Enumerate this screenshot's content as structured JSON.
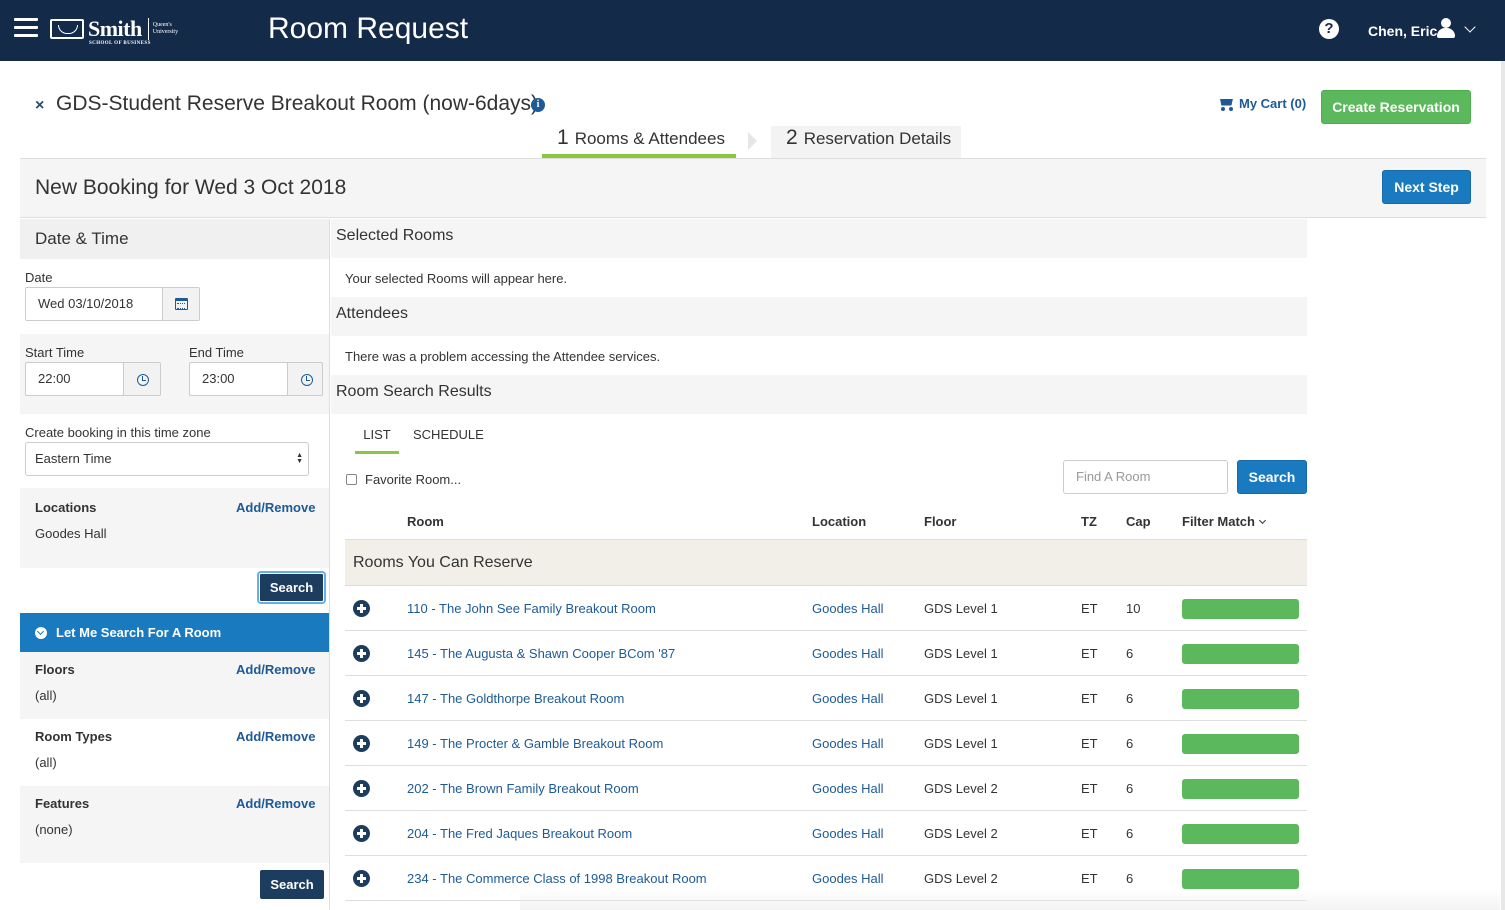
{
  "header": {
    "logo_text": "Smith",
    "logo_sub": "SCHOOL OF BUSINESS",
    "logo_queens": "Queen's University",
    "app_title": "Room Request",
    "help_glyph": "?",
    "user_name": "Chen, Eric",
    "icons": [
      "hamburger-menu-icon",
      "help-icon",
      "user-icon",
      "chevron-down-icon"
    ]
  },
  "page": {
    "title": "GDS-Student Reserve Breakout Room (now-6days)",
    "close_glyph": "×",
    "info_glyph": "i",
    "cart_label": "My Cart (0)",
    "create_button": "Create Reservation",
    "steps": [
      {
        "num": "1",
        "label": "Rooms & Attendees",
        "active": true
      },
      {
        "num": "2",
        "label": "Reservation Details",
        "active": false
      }
    ],
    "booking_title": "New Booking for Wed 3 Oct 2018",
    "next_button": "Next Step"
  },
  "left_panel": {
    "heading": "Date & Time",
    "date_label": "Date",
    "date_value": "Wed 03/10/2018",
    "start_label": "Start Time",
    "start_value": "22:00",
    "end_label": "End Time",
    "end_value": "23:00",
    "tz_label": "Create booking in this time zone",
    "tz_value": "Eastern Time",
    "locations_label": "Locations",
    "locations_link": "Add/Remove",
    "locations_value": "Goodes Hall",
    "search_button": "Search",
    "let_me_search": "Let Me Search For A Room",
    "floors_label": "Floors",
    "floors_link": "Add/Remove",
    "floors_value": "(all)",
    "room_types_label": "Room Types",
    "room_types_link": "Add/Remove",
    "room_types_value": "(all)",
    "features_label": "Features",
    "features_link": "Add/Remove",
    "features_value": "(none)",
    "search_button_2": "Search"
  },
  "main": {
    "selected_rooms_heading": "Selected Rooms",
    "selected_rooms_text": "Your selected Rooms will appear here.",
    "attendees_heading": "Attendees",
    "attendees_text": "There was a problem accessing the Attendee services.",
    "results_heading": "Room Search Results",
    "tabs": [
      {
        "label": "LIST",
        "active": true
      },
      {
        "label": "SCHEDULE",
        "active": false
      }
    ],
    "favorite_label": "Favorite Room...",
    "find_placeholder": "Find A Room",
    "search_button": "Search",
    "columns": {
      "room": "Room",
      "location": "Location",
      "floor": "Floor",
      "tz": "TZ",
      "cap": "Cap",
      "filter": "Filter Match"
    },
    "group_title": "Rooms You Can Reserve",
    "rows": [
      {
        "room": "110 - The John See Family Breakout Room",
        "location": "Goodes Hall",
        "floor": "GDS Level 1",
        "tz": "ET",
        "cap": "10",
        "match": 1.0
      },
      {
        "room": "145 - The Augusta & Shawn Cooper BCom '87",
        "location": "Goodes Hall",
        "floor": "GDS Level 1",
        "tz": "ET",
        "cap": "6",
        "match": 1.0
      },
      {
        "room": "147 - The Goldthorpe Breakout Room",
        "location": "Goodes Hall",
        "floor": "GDS Level 1",
        "tz": "ET",
        "cap": "6",
        "match": 1.0
      },
      {
        "room": "149 - The Procter & Gamble Breakout Room",
        "location": "Goodes Hall",
        "floor": "GDS Level 1",
        "tz": "ET",
        "cap": "6",
        "match": 1.0
      },
      {
        "room": "202 - The Brown Family Breakout Room",
        "location": "Goodes Hall",
        "floor": "GDS Level 2",
        "tz": "ET",
        "cap": "6",
        "match": 1.0
      },
      {
        "room": "204 - The Fred Jaques Breakout Room",
        "location": "Goodes Hall",
        "floor": "GDS Level 2",
        "tz": "ET",
        "cap": "6",
        "match": 1.0
      },
      {
        "room": "234 - The Commerce Class of 1998 Breakout Room",
        "location": "Goodes Hall",
        "floor": "GDS Level 2",
        "tz": "ET",
        "cap": "6",
        "match": 1.0
      }
    ]
  },
  "colors": {
    "nav": "#132a49",
    "primary": "#1a7abf",
    "success": "#5cb85c",
    "accent_underline": "#8cc63f"
  }
}
